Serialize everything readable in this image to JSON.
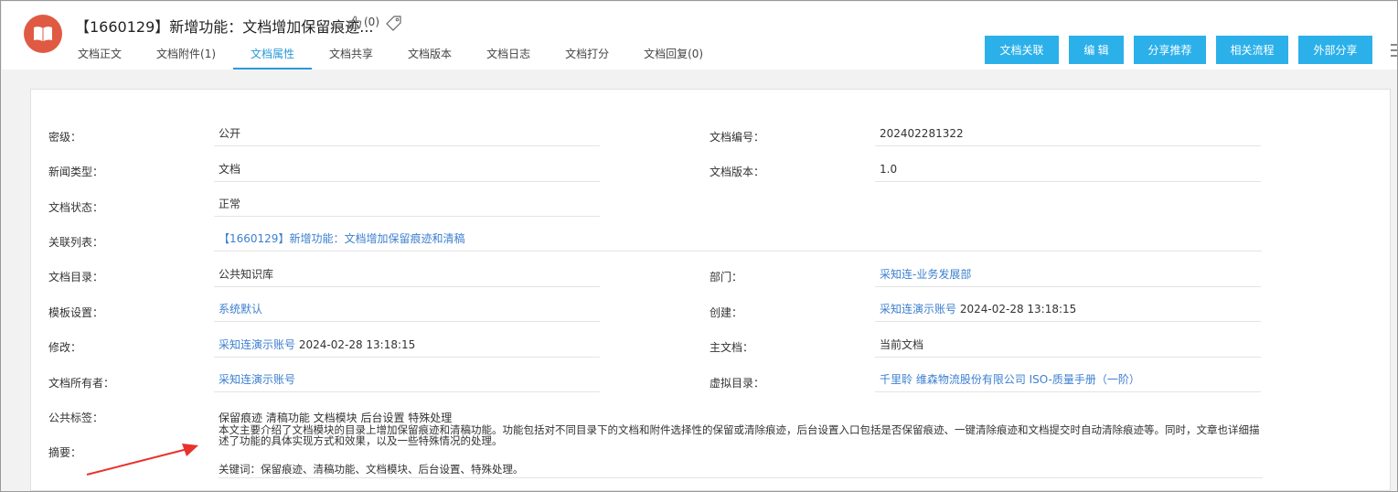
{
  "header": {
    "title": "【1660129】新增功能：文档增加保留痕迹...",
    "like_count": "(0)",
    "tabs": [
      {
        "label": "文档正文"
      },
      {
        "label": "文档附件(1)"
      },
      {
        "label": "文档属性"
      },
      {
        "label": "文档共享"
      },
      {
        "label": "文档版本"
      },
      {
        "label": "文档日志"
      },
      {
        "label": "文档打分"
      },
      {
        "label": "文档回复(0)"
      }
    ],
    "active_tab": "文档属性",
    "buttons": [
      {
        "label": "文档关联"
      },
      {
        "label": "编 辑"
      },
      {
        "label": "分享推荐"
      },
      {
        "label": "相关流程"
      },
      {
        "label": "外部分享"
      }
    ]
  },
  "fields": {
    "security_label": "密级：",
    "security_value": "公开",
    "doc_no_label": "文档编号：",
    "doc_no_value": "202402281322",
    "news_type_label": "新闻类型：",
    "news_type_value": "文档",
    "version_label": "文档版本：",
    "version_value": "1.0",
    "status_label": "文档状态：",
    "status_value": "正常",
    "related_label": "关联列表：",
    "related_value": "【1660129】新增功能：文档增加保留痕迹和清稿",
    "directory_label": "文档目录：",
    "directory_value": "公共知识库",
    "dept_label": "部门：",
    "dept_value": "采知连-业务发展部",
    "template_label": "模板设置：",
    "template_value": "系统默认",
    "created_label": "创建：",
    "created_user": "采知连演示账号",
    "created_time": "2024-02-28 13:18:15",
    "modified_label": "修改：",
    "modified_user": "采知连演示账号",
    "modified_time": "2024-02-28 13:18:15",
    "main_doc_label": "主文档：",
    "main_doc_value": "当前文档",
    "owner_label": "文档所有者：",
    "owner_value": "采知连演示账号",
    "virtual_dir_label": "虚拟目录：",
    "virtual_dir_value": "千里聆 维森物流股份有限公司 ISO-质量手册（一阶）",
    "tags_label": "公共标签：",
    "tags_value": "保留痕迹 清稿功能 文档模块 后台设置 特殊处理",
    "summary_label": "摘要：",
    "summary_text": "本文主要介绍了文档模块的目录上增加保留痕迹和清稿功能。功能包括对不同目录下的文档和附件选择性的保留或清除痕迹，后台设置入口包括是否保留痕迹、一键清除痕迹和文档提交时自动清除痕迹等。同时，文章也详细描述了功能的具体实现方式和效果，以及一些特殊情况的处理。",
    "keywords_text": "关键词：保留痕迹、清稿功能、文档模块、后台设置、特殊处理。"
  },
  "colors": {
    "accent": "#2bb0ea",
    "active_tab": "#2a9ad8",
    "link": "#3d7fcf",
    "logo": "#e05a43",
    "arrow": "#e8322b"
  }
}
